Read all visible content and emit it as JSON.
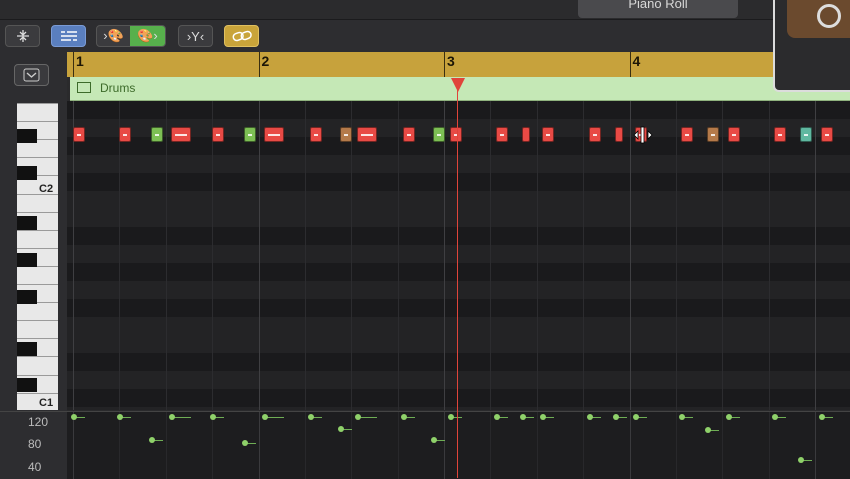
{
  "window": {
    "tab_label": "Piano Roll"
  },
  "toolbar": {
    "buttons": [
      {
        "name": "collapse-button",
        "glyph": "⤓"
      },
      {
        "name": "midi-in-button",
        "glyph": "☰"
      },
      {
        "name": "instrument-palette-button",
        "glyph": "›🎨 🎨›"
      },
      {
        "name": "filter-button",
        "glyph": "›Y‹"
      },
      {
        "name": "link-button",
        "glyph": "🔗"
      }
    ]
  },
  "ruler": {
    "bars": [
      "1",
      "2",
      "3",
      "4"
    ]
  },
  "region": {
    "name": "Drums"
  },
  "keyboard": {
    "labels": [
      "C2",
      "C1"
    ]
  },
  "velocity": {
    "scale": [
      "120",
      "80",
      "40"
    ]
  },
  "notes": [
    {
      "bar": 1.0,
      "color": "#e84a45"
    },
    {
      "bar": 1.25,
      "color": "#e84a45"
    },
    {
      "bar": 1.42,
      "color": "#7dbf54"
    },
    {
      "bar": 1.53,
      "color": "#e84a45",
      "wide": true
    },
    {
      "bar": 1.75,
      "color": "#e84a45"
    },
    {
      "bar": 1.92,
      "color": "#7dbf54"
    },
    {
      "bar": 2.03,
      "color": "#e84a45",
      "wide": true
    },
    {
      "bar": 2.28,
      "color": "#e84a45"
    },
    {
      "bar": 2.44,
      "color": "#b47a4a"
    },
    {
      "bar": 2.53,
      "color": "#e84a45",
      "wide": true
    },
    {
      "bar": 2.78,
      "color": "#e84a45"
    },
    {
      "bar": 2.94,
      "color": "#7dbf54"
    },
    {
      "bar": 3.03,
      "color": "#e84a45"
    },
    {
      "bar": 3.28,
      "color": "#e84a45"
    },
    {
      "bar": 3.42,
      "color": "#e84a45",
      "thin": true
    },
    {
      "bar": 3.53,
      "color": "#e84a45"
    },
    {
      "bar": 3.78,
      "color": "#e84a45"
    },
    {
      "bar": 3.92,
      "color": "#e84a45",
      "thin": true
    },
    {
      "bar": 4.03,
      "color": "#e84a45"
    },
    {
      "bar": 4.28,
      "color": "#e84a45"
    },
    {
      "bar": 4.42,
      "color": "#b47a4a"
    },
    {
      "bar": 4.53,
      "color": "#e84a45"
    },
    {
      "bar": 4.78,
      "color": "#e84a45"
    },
    {
      "bar": 4.92,
      "color": "#5fb8a0"
    },
    {
      "bar": 5.03,
      "color": "#e84a45"
    }
  ],
  "velocities": [
    {
      "bar": 1.0,
      "v": 120
    },
    {
      "bar": 1.25,
      "v": 120
    },
    {
      "bar": 1.42,
      "v": 80
    },
    {
      "bar": 1.53,
      "v": 120
    },
    {
      "bar": 1.75,
      "v": 120
    },
    {
      "bar": 1.92,
      "v": 75
    },
    {
      "bar": 2.03,
      "v": 120
    },
    {
      "bar": 2.28,
      "v": 120
    },
    {
      "bar": 2.44,
      "v": 100
    },
    {
      "bar": 2.53,
      "v": 120
    },
    {
      "bar": 2.78,
      "v": 120
    },
    {
      "bar": 2.94,
      "v": 80
    },
    {
      "bar": 3.03,
      "v": 120
    },
    {
      "bar": 3.28,
      "v": 120
    },
    {
      "bar": 3.42,
      "v": 120
    },
    {
      "bar": 3.53,
      "v": 120
    },
    {
      "bar": 3.78,
      "v": 120
    },
    {
      "bar": 3.92,
      "v": 120
    },
    {
      "bar": 4.03,
      "v": 120
    },
    {
      "bar": 4.28,
      "v": 120
    },
    {
      "bar": 4.42,
      "v": 98
    },
    {
      "bar": 4.53,
      "v": 120
    },
    {
      "bar": 4.78,
      "v": 120
    },
    {
      "bar": 4.92,
      "v": 45
    },
    {
      "bar": 5.03,
      "v": 120
    }
  ],
  "colors": {
    "ruler": "#c7a23c",
    "region": "#c5e8b6",
    "playhead": "#e0443a",
    "velocity_dot": "#8fd16a"
  },
  "playhead_bar": 3.05
}
